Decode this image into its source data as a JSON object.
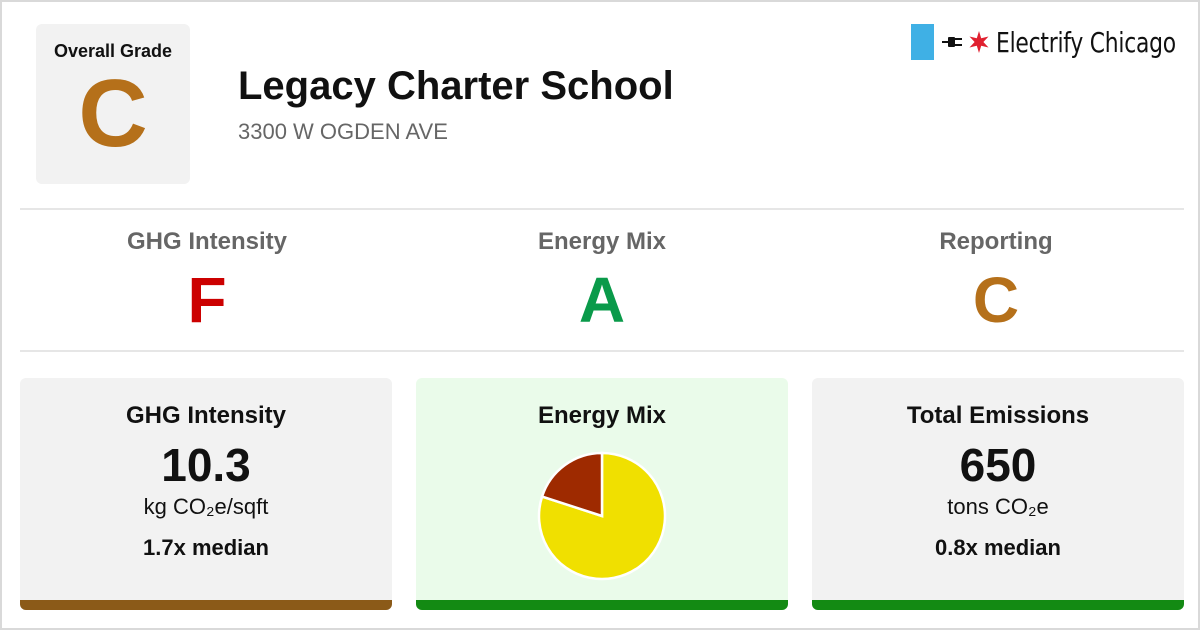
{
  "overall": {
    "label": "Overall Grade",
    "grade": "C",
    "grade_color": "#b5701a"
  },
  "school": {
    "name": "Legacy Charter School",
    "address": "3300 W OGDEN AVE"
  },
  "brand": {
    "name": "Electrify Chicago",
    "flag_color": "#3fb0e5",
    "star_color": "#e0202f",
    "icons": [
      "plug-icon",
      "star-icon"
    ]
  },
  "grades": [
    {
      "label": "GHG Intensity",
      "value": "F",
      "color": "#cc0000"
    },
    {
      "label": "Energy Mix",
      "value": "A",
      "color": "#0a9a4a"
    },
    {
      "label": "Reporting",
      "value": "C",
      "color": "#b5701a"
    }
  ],
  "cards": {
    "ghg": {
      "title": "GHG Intensity",
      "value": "10.3",
      "unit": "kg CO₂e/sqft",
      "median": "1.7x median",
      "bar_color": "#8b5a18"
    },
    "mix": {
      "title": "Energy Mix",
      "bar_color": "#138a13",
      "background": "#eafbea"
    },
    "total": {
      "title": "Total Emissions",
      "value": "650",
      "unit": "tons CO₂e",
      "median": "0.8x median",
      "bar_color": "#138a13"
    }
  },
  "chart_data": {
    "type": "pie",
    "title": "",
    "values": [
      0.8,
      0.2
    ],
    "colors": [
      "#f0e000",
      "#9e2a00"
    ],
    "start_angle_deg": 0,
    "legend": false
  }
}
